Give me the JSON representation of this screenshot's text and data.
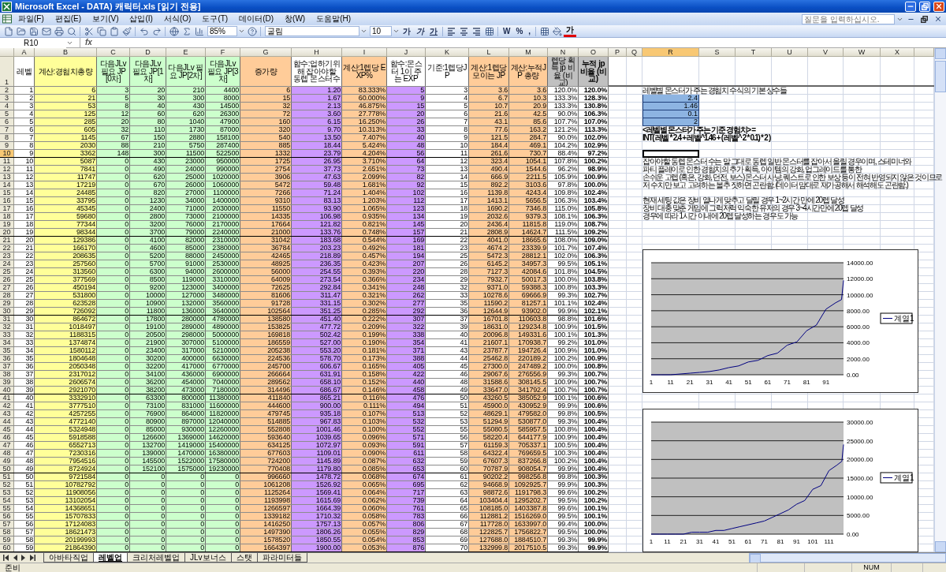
{
  "window": {
    "title": "Microsoft Excel - DATA) 캐릭터.xls  [읽기 전용]"
  },
  "menu": [
    "파일(F)",
    "편집(E)",
    "보기(V)",
    "삽입(I)",
    "서식(O)",
    "도구(T)",
    "데이터(D)",
    "창(W)",
    "도움말(H)"
  ],
  "help_box": {
    "placeholder": "질문을 입력하십시오."
  },
  "toolbar": {
    "zoom": "85%",
    "font": "굴림",
    "font_size": "10",
    "format_buttons": [
      "가",
      "가",
      "가"
    ],
    "number_buttons": [
      "W",
      "%",
      ","
    ],
    "font_color_button": "가"
  },
  "formula_bar": {
    "name_box": "R10",
    "function_label": "fx"
  },
  "columns": [
    {
      "label": "A",
      "selected": false
    },
    {
      "label": "B",
      "selected": false
    },
    {
      "label": "C",
      "selected": false
    },
    {
      "label": "D",
      "selected": false
    },
    {
      "label": "E",
      "selected": false
    },
    {
      "label": "F",
      "selected": false
    },
    {
      "label": "G",
      "selected": false
    },
    {
      "label": "H",
      "selected": false
    },
    {
      "label": "I",
      "selected": false
    },
    {
      "label": "J",
      "selected": false
    },
    {
      "label": "K",
      "selected": false
    },
    {
      "label": "L",
      "selected": false
    },
    {
      "label": "M",
      "selected": false
    },
    {
      "label": "N",
      "selected": false
    },
    {
      "label": "O",
      "selected": false
    },
    {
      "label": "P",
      "selected": false
    },
    {
      "label": "Q",
      "selected": false
    },
    {
      "label": "R",
      "selected": true
    },
    {
      "label": "S",
      "selected": false
    },
    {
      "label": "T",
      "selected": false
    },
    {
      "label": "U",
      "selected": false
    },
    {
      "label": "V",
      "selected": false
    },
    {
      "label": "W",
      "selected": false
    },
    {
      "label": "X",
      "selected": false
    }
  ],
  "header_row": {
    "n": "1",
    "cells": [
      "레벨",
      "계산:경험치총량",
      "다음JLv 필요 JP[0차]",
      "다음JLv 필요 JP[1차]",
      "다음JLv 필요 JP[2차]",
      "다음JLv 필요 JP[3차]",
      "증가량",
      "함수:업하기위해 잡아야할 동렙 몬스터수",
      "계산:1렙당 EXP%",
      "함수:몬스터 1이 주는 EXP",
      "기준:1렙당JP",
      "계산:1렙당 모이는 JP",
      "계산:누적JP 총량",
      "렙당 획득 jp 비율 (비교)",
      "누적 jp 비율 (비교)"
    ]
  },
  "rows": [
    {
      "n": "2",
      "selected": false,
      "cells": [
        "1",
        "6",
        "3",
        "20",
        "210",
        "4400",
        "6",
        "1.20",
        "83.333%",
        "5",
        "3",
        "3.6",
        "3.6",
        "120.0%",
        "120.0%"
      ]
    },
    {
      "n": "3",
      "selected": false,
      "cells": [
        "2",
        "21",
        "5",
        "30",
        "300",
        "8000",
        "15",
        "1.67",
        "60.000%",
        "9",
        "4",
        "6.7",
        "10.3",
        "133.3%",
        "128.3%"
      ]
    },
    {
      "n": "4",
      "selected": false,
      "cells": [
        "3",
        "53",
        "8",
        "40",
        "430",
        "14500",
        "32",
        "2.13",
        "46.875%",
        "15",
        "5",
        "10.7",
        "20.9",
        "133.3%",
        "130.8%"
      ]
    },
    {
      "n": "5",
      "selected": false,
      "cells": [
        "4",
        "125",
        "12",
        "60",
        "620",
        "26300",
        "72",
        "3.60",
        "27.778%",
        "20",
        "6",
        "21.6",
        "42.5",
        "90.0%",
        "106.3%"
      ]
    },
    {
      "n": "6",
      "selected": false,
      "cells": [
        "5",
        "285",
        "20",
        "80",
        "1040",
        "47900",
        "160",
        "6.15",
        "16.250%",
        "26",
        "7",
        "43.1",
        "85.6",
        "107.7%",
        "107.0%"
      ]
    },
    {
      "n": "7",
      "selected": false,
      "cells": [
        "6",
        "605",
        "32",
        "110",
        "1730",
        "87000",
        "320",
        "9.70",
        "10.313%",
        "33",
        "8",
        "77.6",
        "163.2",
        "121.2%",
        "113.3%"
      ]
    },
    {
      "n": "8",
      "selected": false,
      "cells": [
        "7",
        "1145",
        "67",
        "150",
        "2880",
        "158100",
        "540",
        "13.50",
        "7.407%",
        "40",
        "9",
        "121.5",
        "284.7",
        "90.0%",
        "102.0%"
      ]
    },
    {
      "n": "9",
      "selected": false,
      "cells": [
        "8",
        "2030",
        "88",
        "210",
        "5750",
        "287400",
        "885",
        "18.44",
        "5.424%",
        "48",
        "10",
        "184.4",
        "469.1",
        "104.2%",
        "102.9%"
      ]
    },
    {
      "n": "10",
      "selected": true,
      "cells": [
        "9",
        "3362",
        "148",
        "300",
        "11500",
        "522500",
        "1332",
        "23.79",
        "4.204%",
        "56",
        "11",
        "261.6",
        "730.7",
        "88.4%",
        "97.2%"
      ]
    },
    {
      "n": "11",
      "selected": false,
      "cells": [
        "10",
        "5087",
        "0",
        "430",
        "23000",
        "950000",
        "1725",
        "26.95",
        "3.710%",
        "64",
        "12",
        "323.4",
        "1054.1",
        "107.8%",
        "100.2%"
      ]
    },
    {
      "n": "12",
      "selected": false,
      "cells": [
        "11",
        "7841",
        "0",
        "490",
        "24000",
        "990000",
        "2754",
        "37.73",
        "2.651%",
        "73",
        "13",
        "490.4",
        "1544.6",
        "96.2%",
        "98.9%"
      ]
    },
    {
      "n": "13",
      "selected": false,
      "cells": [
        "12",
        "11747",
        "0",
        "620",
        "25000",
        "1020000",
        "3906",
        "47.63",
        "2.099%",
        "82",
        "14",
        "666.9",
        "2211.5",
        "105.9%",
        "100.9%"
      ]
    },
    {
      "n": "14",
      "selected": false,
      "cells": [
        "13",
        "17219",
        "0",
        "670",
        "26000",
        "1060000",
        "5472",
        "59.48",
        "1.681%",
        "92",
        "15",
        "892.2",
        "3103.6",
        "97.8%",
        "100.0%"
      ]
    },
    {
      "n": "15",
      "selected": false,
      "cells": [
        "14",
        "24485",
        "0",
        "820",
        "27000",
        "1100000",
        "7266",
        "71.24",
        "1.404%",
        "102",
        "16",
        "1139.8",
        "4243.4",
        "109.8%",
        "102.4%"
      ]
    },
    {
      "n": "16",
      "selected": false,
      "cells": [
        "15",
        "33795",
        "0",
        "1230",
        "34000",
        "1400000",
        "9310",
        "83.13",
        "1.203%",
        "112",
        "17",
        "1413.1",
        "5656.5",
        "106.3%",
        "103.4%"
      ]
    },
    {
      "n": "17",
      "selected": false,
      "cells": [
        "16",
        "45345",
        "0",
        "2400",
        "71000",
        "2030000",
        "11550",
        "93.90",
        "1.065%",
        "123",
        "18",
        "1690.2",
        "7346.8",
        "115.0%",
        "105.8%"
      ]
    },
    {
      "n": "18",
      "selected": false,
      "cells": [
        "17",
        "59680",
        "0",
        "2800",
        "73000",
        "2100000",
        "14335",
        "106.98",
        "0.935%",
        "134",
        "19",
        "2032.6",
        "9379.3",
        "108.1%",
        "106.3%"
      ]
    },
    {
      "n": "19",
      "selected": false,
      "cells": [
        "18",
        "77344",
        "0",
        "3200",
        "76000",
        "2170000",
        "17664",
        "121.82",
        "0.821%",
        "145",
        "20",
        "2436.4",
        "11815.8",
        "119.0%",
        "108.7%"
      ]
    },
    {
      "n": "20",
      "selected": false,
      "cells": [
        "19",
        "98344",
        "0",
        "3700",
        "79000",
        "2240000",
        "21000",
        "133.76",
        "0.748%",
        "157",
        "21",
        "2808.9",
        "14624.7",
        "111.5%",
        "109.2%"
      ]
    },
    {
      "n": "21",
      "selected": false,
      "cells": [
        "20",
        "129386",
        "0",
        "4100",
        "82000",
        "2310000",
        "31042",
        "183.68",
        "0.544%",
        "169",
        "22",
        "4041.0",
        "18665.6",
        "108.0%",
        "109.0%"
      ]
    },
    {
      "n": "22",
      "selected": false,
      "cells": [
        "21",
        "166170",
        "0",
        "4600",
        "85000",
        "2380000",
        "36784",
        "203.23",
        "0.492%",
        "181",
        "23",
        "4674.2",
        "23339.9",
        "101.7%",
        "107.4%"
      ]
    },
    {
      "n": "23",
      "selected": false,
      "cells": [
        "22",
        "208635",
        "0",
        "5200",
        "88000",
        "2450000",
        "42465",
        "218.89",
        "0.457%",
        "194",
        "25",
        "5472.3",
        "28812.1",
        "102.0%",
        "106.3%"
      ]
    },
    {
      "n": "24",
      "selected": false,
      "cells": [
        "23",
        "257560",
        "0",
        "5700",
        "91000",
        "2530000",
        "48925",
        "236.35",
        "0.423%",
        "207",
        "26",
        "6145.2",
        "34957.3",
        "99.5%",
        "105.1%"
      ]
    },
    {
      "n": "25",
      "selected": false,
      "cells": [
        "24",
        "313560",
        "0",
        "6300",
        "94000",
        "2600000",
        "56000",
        "254.55",
        "0.393%",
        "220",
        "28",
        "7127.3",
        "42084.6",
        "101.8%",
        "104.5%"
      ]
    },
    {
      "n": "26",
      "selected": false,
      "cells": [
        "25",
        "377569",
        "0",
        "8500",
        "119000",
        "3310000",
        "64009",
        "273.54",
        "0.366%",
        "234",
        "29",
        "7932.7",
        "50017.3",
        "100.0%",
        "103.8%"
      ]
    },
    {
      "n": "27",
      "selected": false,
      "cells": [
        "26",
        "450194",
        "0",
        "9200",
        "123000",
        "3400000",
        "72625",
        "292.84",
        "0.341%",
        "248",
        "32",
        "9371.0",
        "59388.3",
        "100.8%",
        "103.3%"
      ]
    },
    {
      "n": "28",
      "selected": false,
      "cells": [
        "27",
        "531800",
        "0",
        "10000",
        "127000",
        "3480000",
        "81606",
        "311.47",
        "0.321%",
        "262",
        "33",
        "10278.6",
        "69666.9",
        "99.3%",
        "102.7%"
      ]
    },
    {
      "n": "29",
      "selected": false,
      "cells": [
        "28",
        "623528",
        "0",
        "10900",
        "132000",
        "3560000",
        "91728",
        "331.15",
        "0.302%",
        "277",
        "35",
        "11590.2",
        "81257.1",
        "101.1%",
        "102.4%"
      ]
    },
    {
      "n": "30",
      "selected": false,
      "cells": [
        "29",
        "726092",
        "0",
        "11800",
        "136000",
        "3640000",
        "102564",
        "351.25",
        "0.285%",
        "292",
        "36",
        "12644.9",
        "93902.0",
        "99.9%",
        "102.1%"
      ]
    },
    {
      "n": "31",
      "selected": false,
      "cells": [
        "30",
        "864672",
        "0",
        "17800",
        "280000",
        "4780000",
        "138580",
        "451.40",
        "0.222%",
        "307",
        "37",
        "16701.8",
        "110603.8",
        "98.8%",
        "101.6%"
      ]
    },
    {
      "n": "32",
      "selected": false,
      "cells": [
        "31",
        "1018497",
        "0",
        "19100",
        "289000",
        "4890000",
        "153825",
        "477.72",
        "0.209%",
        "322",
        "39",
        "18631.0",
        "129234.8",
        "100.9%",
        "101.5%"
      ]
    },
    {
      "n": "33",
      "selected": false,
      "cells": [
        "32",
        "1188315",
        "0",
        "20500",
        "298000",
        "5000000",
        "169818",
        "502.42",
        "0.199%",
        "338",
        "40",
        "20096.8",
        "149331.6",
        "100.1%",
        "101.3%"
      ]
    },
    {
      "n": "34",
      "selected": false,
      "cells": [
        "33",
        "1374874",
        "0",
        "21900",
        "307000",
        "5100000",
        "186559",
        "527.00",
        "0.190%",
        "354",
        "41",
        "21607.1",
        "170938.7",
        "99.2%",
        "101.0%"
      ]
    },
    {
      "n": "35",
      "selected": false,
      "cells": [
        "34",
        "1580112",
        "0",
        "23400",
        "317000",
        "5210000",
        "205238",
        "553.20",
        "0.181%",
        "371",
        "43",
        "23787.7",
        "194726.4",
        "100.9%",
        "101.0%"
      ]
    },
    {
      "n": "36",
      "selected": false,
      "cells": [
        "35",
        "1804648",
        "0",
        "30200",
        "400000",
        "6630000",
        "224536",
        "578.70",
        "0.173%",
        "388",
        "44",
        "25462.8",
        "220189.2",
        "100.2%",
        "100.9%"
      ]
    },
    {
      "n": "37",
      "selected": false,
      "cells": [
        "36",
        "2050348",
        "0",
        "32200",
        "417000",
        "6770000",
        "245700",
        "606.67",
        "0.165%",
        "405",
        "45",
        "27300.0",
        "247489.2",
        "100.0%",
        "100.8%"
      ]
    },
    {
      "n": "38",
      "selected": false,
      "cells": [
        "37",
        "2317012",
        "0",
        "34100",
        "436000",
        "6900000",
        "266664",
        "631.91",
        "0.158%",
        "422",
        "46",
        "29067.6",
        "276556.9",
        "99.3%",
        "100.7%"
      ]
    },
    {
      "n": "39",
      "selected": false,
      "cells": [
        "38",
        "2606574",
        "0",
        "36200",
        "454000",
        "7040000",
        "289562",
        "658.10",
        "0.152%",
        "440",
        "48",
        "31588.6",
        "308145.5",
        "100.9%",
        "100.7%"
      ]
    },
    {
      "n": "40",
      "selected": false,
      "cells": [
        "39",
        "2921070",
        "0",
        "38200",
        "473000",
        "7180000",
        "314496",
        "686.67",
        "0.146%",
        "458",
        "49",
        "33647.0",
        "341792.4",
        "100.7%",
        "100.7%"
      ]
    },
    {
      "n": "41",
      "selected": false,
      "cells": [
        "40",
        "3332910",
        "0",
        "63300",
        "800000",
        "11380000",
        "411840",
        "865.21",
        "0.116%",
        "476",
        "50",
        "43260.5",
        "385052.9",
        "100.1%",
        "100.6%"
      ]
    },
    {
      "n": "42",
      "selected": false,
      "cells": [
        "41",
        "3777510",
        "0",
        "73100",
        "831000",
        "11600000",
        "444600",
        "900.00",
        "0.111%",
        "494",
        "51",
        "45900.0",
        "430952.9",
        "99.9%",
        "100.6%"
      ]
    },
    {
      "n": "43",
      "selected": false,
      "cells": [
        "42",
        "4257255",
        "0",
        "76900",
        "864000",
        "11820000",
        "479745",
        "935.18",
        "0.107%",
        "513",
        "52",
        "48629.1",
        "479582.0",
        "99.8%",
        "100.5%"
      ]
    },
    {
      "n": "44",
      "selected": false,
      "cells": [
        "43",
        "4772140",
        "0",
        "80900",
        "897000",
        "12040000",
        "514885",
        "967.83",
        "0.103%",
        "532",
        "53",
        "51294.9",
        "530877.0",
        "99.3%",
        "100.4%"
      ]
    },
    {
      "n": "45",
      "selected": false,
      "cells": [
        "44",
        "5324948",
        "0",
        "85000",
        "930000",
        "12260000",
        "552808",
        "1001.46",
        "0.100%",
        "552",
        "55",
        "55080.5",
        "585957.5",
        "100.8%",
        "100.4%"
      ]
    },
    {
      "n": "46",
      "selected": false,
      "cells": [
        "45",
        "5918588",
        "0",
        "126600",
        "1369000",
        "14620000",
        "593640",
        "1039.65",
        "0.096%",
        "571",
        "56",
        "58220.4",
        "644177.9",
        "100.9%",
        "100.4%"
      ]
    },
    {
      "n": "47",
      "selected": false,
      "cells": [
        "46",
        "6552713",
        "0",
        "132700",
        "1419000",
        "15400000",
        "634125",
        "1072.97",
        "0.093%",
        "591",
        "57",
        "61159.3",
        "705337.1",
        "100.5%",
        "100.4%"
      ]
    },
    {
      "n": "48",
      "selected": false,
      "cells": [
        "47",
        "7230316",
        "0",
        "139000",
        "1470000",
        "16380000",
        "677603",
        "1109.01",
        "0.090%",
        "611",
        "58",
        "64322.4",
        "769659.5",
        "100.3%",
        "100.4%"
      ]
    },
    {
      "n": "49",
      "selected": false,
      "cells": [
        "48",
        "7954516",
        "0",
        "145500",
        "1522000",
        "17580000",
        "724200",
        "1145.89",
        "0.087%",
        "632",
        "59",
        "67607.3",
        "837266.8",
        "100.2%",
        "100.4%"
      ]
    },
    {
      "n": "50",
      "selected": false,
      "cells": [
        "49",
        "8724924",
        "0",
        "152100",
        "1575000",
        "19230000",
        "770408",
        "1179.80",
        "0.085%",
        "653",
        "60",
        "70787.9",
        "908054.7",
        "99.9%",
        "100.4%"
      ]
    },
    {
      "n": "51",
      "selected": false,
      "cells": [
        "50",
        "9721584",
        "0",
        "0",
        "0",
        "0",
        "996660",
        "1478.72",
        "0.068%",
        "674",
        "61",
        "90202.2",
        "998256.8",
        "99.8%",
        "100.3%"
      ]
    },
    {
      "n": "52",
      "selected": false,
      "cells": [
        "51",
        "10782792",
        "0",
        "0",
        "0",
        "0",
        "1061208",
        "1526.92",
        "0.065%",
        "695",
        "62",
        "94668.9",
        "1092925.7",
        "99.9%",
        "100.3%"
      ]
    },
    {
      "n": "53",
      "selected": false,
      "cells": [
        "52",
        "11908056",
        "0",
        "0",
        "0",
        "0",
        "1125264",
        "1569.41",
        "0.064%",
        "717",
        "63",
        "98872.6",
        "1191798.3",
        "99.6%",
        "100.2%"
      ]
    },
    {
      "n": "54",
      "selected": false,
      "cells": [
        "53",
        "13102054",
        "0",
        "0",
        "0",
        "0",
        "1193998",
        "1615.69",
        "0.062%",
        "739",
        "64",
        "103404.4",
        "1295202.7",
        "99.5%",
        "100.2%"
      ]
    },
    {
      "n": "55",
      "selected": false,
      "cells": [
        "54",
        "14368651",
        "0",
        "0",
        "0",
        "0",
        "1266597",
        "1664.39",
        "0.060%",
        "761",
        "65",
        "108185.0",
        "1403387.8",
        "99.6%",
        "100.1%"
      ]
    },
    {
      "n": "56",
      "selected": false,
      "cells": [
        "55",
        "15707833",
        "0",
        "0",
        "0",
        "0",
        "1339182",
        "1710.32",
        "0.058%",
        "783",
        "66",
        "112881.2",
        "1516269.0",
        "99.5%",
        "100.1%"
      ]
    },
    {
      "n": "57",
      "selected": false,
      "cells": [
        "56",
        "17124083",
        "0",
        "0",
        "0",
        "0",
        "1416250",
        "1757.13",
        "0.057%",
        "806",
        "67",
        "117728.0",
        "1633997.0",
        "99.4%",
        "100.0%"
      ]
    },
    {
      "n": "58",
      "selected": false,
      "cells": [
        "57",
        "18621473",
        "0",
        "0",
        "0",
        "0",
        "1497390",
        "1806.26",
        "0.055%",
        "829",
        "68",
        "122825.7",
        "1756822.7",
        "99.5%",
        "100.0%"
      ]
    },
    {
      "n": "59",
      "selected": false,
      "cells": [
        "58",
        "20199993",
        "0",
        "0",
        "0",
        "0",
        "1578520",
        "1850.55",
        "0.054%",
        "853",
        "69",
        "127688.0",
        "1884510.7",
        "99.3%",
        "99.9%"
      ]
    },
    {
      "n": "60",
      "selected": false,
      "cells": [
        "59",
        "21864390",
        "0",
        "0",
        "0",
        "0",
        "1664397",
        "1900.00",
        "0.053%",
        "876",
        "70",
        "132999.8",
        "2017510.5",
        "99.3%",
        "99.9%"
      ]
    }
  ],
  "notes": {
    "caption": "레벨별 몬스터가 주는 경험치 수식의 기본 상수들",
    "constants": [
      "2.4",
      "1.46",
      "0.1",
      "2"
    ],
    "formula_title": "<레벨별 몬스터가 주는 기준 경험치> =",
    "formula": "INT( 레벨 * 2.4 + 레벨^1.46 + ( 레벨^ 2 * 0.1) * 2 )",
    "paragraph_1": [
      "잡아야할 동렙 몬스터 수는 말 그대로 동렙 일반 몬스터를 잡아서 올릴 경우이며, 스테미너와",
      "파티 플레이로 인한 경험치의 추가 획득, 아이템의 강화, 업그레이드를 통한",
      "손쉬운 고렙 (혹은, 강화, 던전, 보스) 몬스터 사냥, 퀘스트로 인한 보상 등이 전혀 반영되지 않은 것이므로",
      "저 수치만 보고 고려하는 볼추 짓하면 곤란함. (데이터 맘대로 재가공해서 해석해도 곤란함.)"
    ],
    "paragraph_2": [
      "현재 세팅 값은 장비 열나게 맞추고 달릴 경우 1~2시간 만에 20렙 달성",
      "장비 대충 맞춘 게임에 그럭저럭 익숙한 유저의 경우 3~4시간만에 20렙 달성",
      "경우에 따라 1시간 이내에 20렙 달성하는 경우도 가능"
    ]
  },
  "charts": [
    {
      "chart_data": {
        "type": "line",
        "grid": true,
        "x": [
          1,
          6,
          11,
          16,
          21,
          26,
          31,
          36,
          41,
          46,
          51,
          56,
          61,
          66,
          71,
          76,
          81,
          86,
          91,
          96,
          99,
          100
        ],
        "xlim": [
          1,
          100
        ],
        "ylim": [
          0,
          14000
        ],
        "xticks": [
          1,
          11,
          21,
          31,
          41,
          51,
          61,
          71,
          81,
          91
        ],
        "yticks": [
          {
            "value": 0,
            "label": "0.00"
          },
          {
            "value": 2000,
            "label": "2000.00"
          },
          {
            "value": 4000,
            "label": "4000.00"
          },
          {
            "value": 6000,
            "label": "6000.00"
          },
          {
            "value": 8000,
            "label": "8000.00"
          },
          {
            "value": 10000,
            "label": "10000.00"
          },
          {
            "value": 12000,
            "label": "12000.00"
          },
          {
            "value": 14000,
            "label": "14000.00"
          }
        ],
        "series": [
          {
            "name": "계열1",
            "color": "#000080",
            "values": [
              0,
              0,
              0,
              100,
              200,
              300,
              400,
              600,
              900,
              1100,
              1600,
              1800,
              2400,
              2700,
              3700,
              4100,
              5500,
              6200,
              8200,
              9000,
              9400,
              11800
            ]
          }
        ]
      }
    },
    {
      "chart_data": {
        "type": "line",
        "grid": true,
        "x": [
          1,
          6,
          11,
          16,
          21,
          26,
          31,
          36,
          41,
          46,
          51,
          56,
          61,
          66,
          71,
          76,
          81,
          86,
          91,
          96,
          101,
          106,
          111,
          116,
          119,
          120
        ],
        "xlim": [
          1,
          120
        ],
        "ylim": [
          0,
          30000
        ],
        "xticks": [
          1,
          11,
          21,
          31,
          41,
          51,
          61,
          71,
          81,
          91,
          101,
          111
        ],
        "yticks": [
          {
            "value": 0,
            "label": "0.00"
          },
          {
            "value": 5000,
            "label": "5000.00"
          },
          {
            "value": 10000,
            "label": "10000.00"
          },
          {
            "value": 15000,
            "label": "15000.00"
          },
          {
            "value": 20000,
            "label": "20000.00"
          },
          {
            "value": 25000,
            "label": "25000.00"
          },
          {
            "value": 30000,
            "label": "30000.00"
          }
        ],
        "series": [
          {
            "name": "계열1",
            "color": "#000080",
            "values": [
              0,
              0,
              0,
              0,
              0,
              500,
              500,
              500,
              1000,
              1000,
              1500,
              2000,
              2500,
              3000,
              3500,
              4500,
              5500,
              6500,
              8000,
              9000,
              12000,
              13000,
              17000,
              18500,
              19500,
              24000
            ]
          }
        ]
      }
    }
  ],
  "sheet_tabs": [
    {
      "label": "아바타직업",
      "selected": false
    },
    {
      "label": "레벨업",
      "selected": true
    },
    {
      "label": "크리처레벨업",
      "selected": false
    },
    {
      "label": "JLv보너스",
      "selected": false
    },
    {
      "label": "스탯",
      "selected": false
    },
    {
      "label": "파라미터들",
      "selected": false
    }
  ],
  "status_bar": {
    "text": "준비",
    "indicator": "NUM"
  }
}
